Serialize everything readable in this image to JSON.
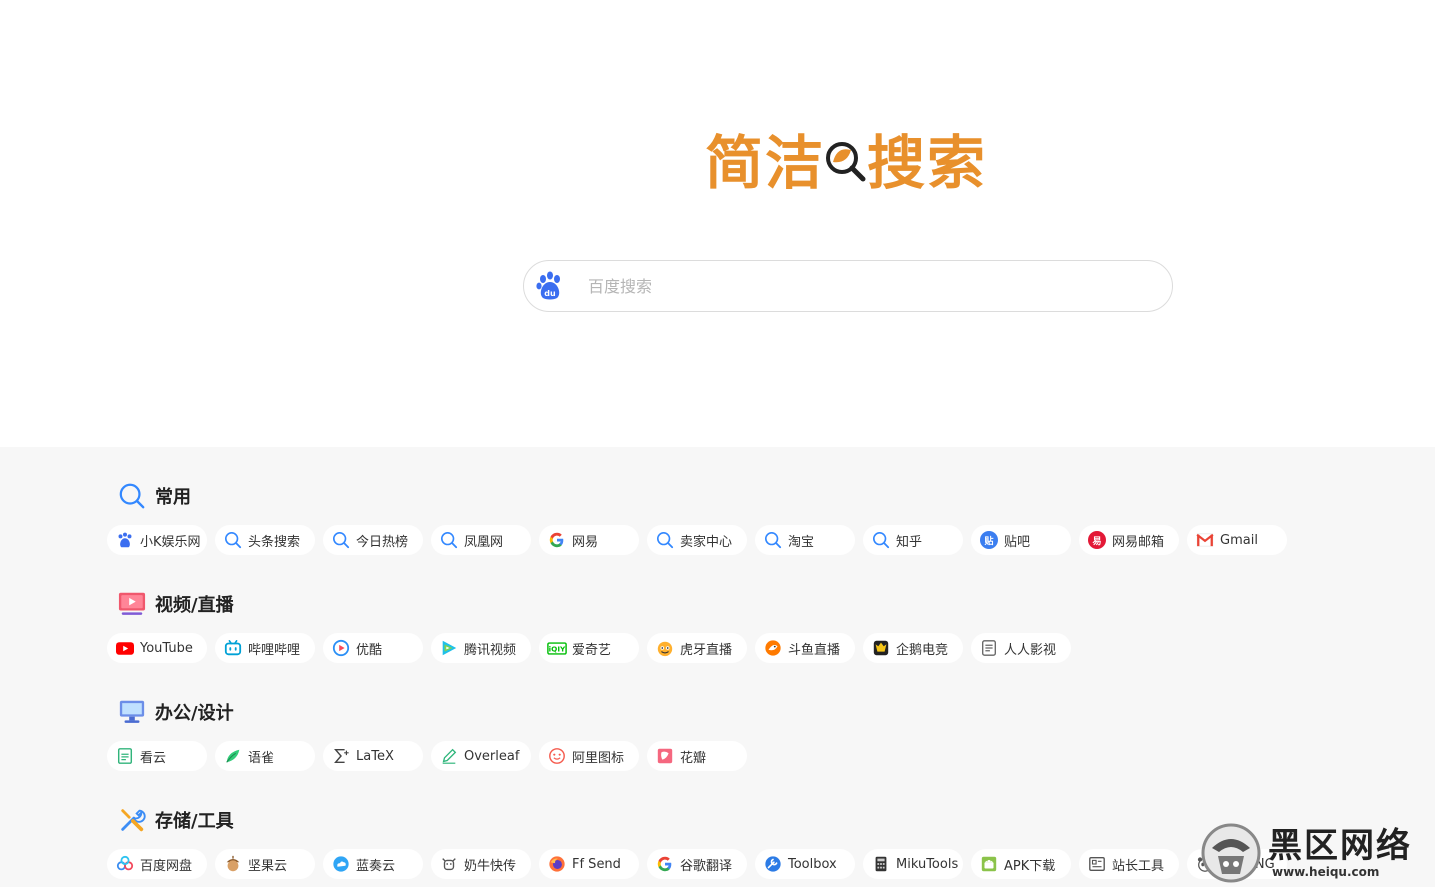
{
  "logo": {
    "text_left": "简洁",
    "text_right": "搜索"
  },
  "search": {
    "engine_icon": "baidu-paw-icon",
    "placeholder": "百度搜索",
    "value": ""
  },
  "sections": [
    {
      "title": "常用",
      "icon": "search-icon",
      "items": [
        {
          "label": "小K娱乐网",
          "icon": "baidu-paw-icon"
        },
        {
          "label": "头条搜索",
          "icon": "search-icon"
        },
        {
          "label": "今日热榜",
          "icon": "search-icon"
        },
        {
          "label": "凤凰网",
          "icon": "search-icon"
        },
        {
          "label": "网易",
          "icon": "google-g-icon"
        },
        {
          "label": "卖家中心",
          "icon": "search-icon"
        },
        {
          "label": "淘宝",
          "icon": "search-icon"
        },
        {
          "label": "知乎",
          "icon": "search-icon"
        },
        {
          "label": "贴吧",
          "icon": "tieba-icon"
        },
        {
          "label": "网易邮箱",
          "icon": "netease-mail-icon"
        },
        {
          "label": "Gmail",
          "icon": "gmail-icon"
        }
      ]
    },
    {
      "title": "视频/直播",
      "icon": "video-icon",
      "items": [
        {
          "label": "YouTube",
          "icon": "youtube-icon"
        },
        {
          "label": "哔哩哔哩",
          "icon": "bilibili-icon"
        },
        {
          "label": "优酷",
          "icon": "youku-icon"
        },
        {
          "label": "腾讯视频",
          "icon": "tencent-video-icon"
        },
        {
          "label": "爱奇艺",
          "icon": "iqiyi-icon"
        },
        {
          "label": "虎牙直播",
          "icon": "huya-icon"
        },
        {
          "label": "斗鱼直播",
          "icon": "douyu-icon"
        },
        {
          "label": "企鹅电竞",
          "icon": "penguin-esports-icon"
        },
        {
          "label": "人人影视",
          "icon": "document-list-icon"
        }
      ]
    },
    {
      "title": "办公/设计",
      "icon": "monitor-icon",
      "items": [
        {
          "label": "看云",
          "icon": "kancloud-icon"
        },
        {
          "label": "语雀",
          "icon": "yuque-icon"
        },
        {
          "label": "LaTeX",
          "icon": "sigma-icon"
        },
        {
          "label": "Overleaf",
          "icon": "pencil-icon"
        },
        {
          "label": "阿里图标",
          "icon": "iconfont-icon"
        },
        {
          "label": "花瓣",
          "icon": "huaban-icon"
        }
      ]
    },
    {
      "title": "存储/工具",
      "icon": "tools-icon",
      "items": [
        {
          "label": "百度网盘",
          "icon": "baidu-netdisk-icon"
        },
        {
          "label": "坚果云",
          "icon": "nut-cloud-icon"
        },
        {
          "label": "蓝奏云",
          "icon": "lanzou-cloud-icon"
        },
        {
          "label": "奶牛快传",
          "icon": "cow-icon"
        },
        {
          "label": "Ff Send",
          "icon": "firefox-icon"
        },
        {
          "label": "谷歌翻译",
          "icon": "google-g-icon"
        },
        {
          "label": "Toolbox",
          "icon": "toolbox-icon"
        },
        {
          "label": "MikuTools",
          "icon": "calculator-icon"
        },
        {
          "label": "APK下载",
          "icon": "android-icon"
        },
        {
          "label": "站长工具",
          "icon": "webmaster-icon"
        },
        {
          "label": "TinyPNG",
          "icon": "panda-icon"
        }
      ]
    }
  ],
  "watermark": {
    "logo": "heiqu-logo-icon",
    "title": "黑区网络",
    "url": "www.heiqu.com"
  },
  "colors": {
    "logo": "#e8902c",
    "links_bg": "#f7f7f7",
    "accent_blue": "#3388ff"
  }
}
